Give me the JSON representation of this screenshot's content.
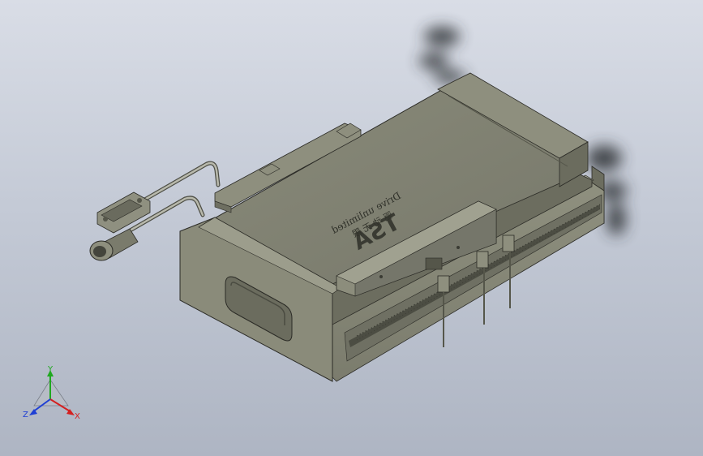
{
  "model": {
    "engraved_text_line1": "Drive unlimited",
    "engraved_text_line2": "驱 动 无 限",
    "logo_text": "TSA"
  },
  "triad": {
    "x_label": "X",
    "y_label": "Y",
    "z_label": "Z",
    "x_color": "#d42020",
    "y_color": "#1fa81f",
    "z_color": "#1f3fd4"
  },
  "colors": {
    "body": "#8f9080",
    "top_face": "#7f806f",
    "dark_face": "#5c5d50",
    "edge": "#2b2b26"
  }
}
